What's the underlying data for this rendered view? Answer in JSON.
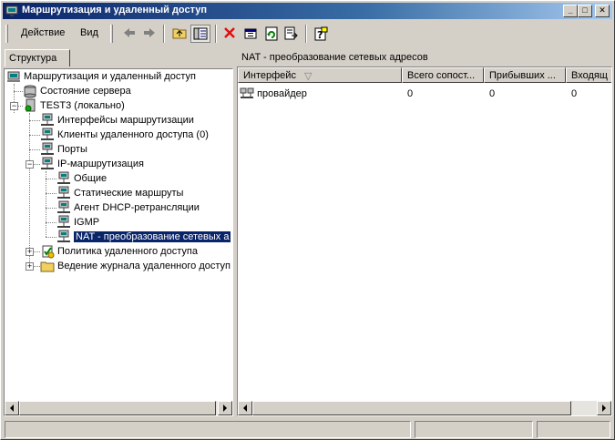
{
  "window": {
    "title": "Маршрутизация и удаленный доступ",
    "controls": {
      "minimize": "_",
      "maximize": "□",
      "close": "✕"
    }
  },
  "menu": {
    "action": "Действие",
    "view": "Вид"
  },
  "toolbar": {
    "icons": [
      "back-arrow-icon",
      "forward-arrow-icon",
      "up-folder-icon",
      "show-hide-tree-icon",
      "delete-icon",
      "properties-icon",
      "refresh-icon",
      "export-list-icon",
      "help-icon"
    ]
  },
  "left_panel": {
    "tab": "Структура",
    "tree": [
      {
        "label": "Маршрутизация и удаленный доступ",
        "icon": "routing-icon"
      },
      {
        "label": "Состояние сервера",
        "icon": "server-status-icon"
      },
      {
        "label": "TEST3 (локально)",
        "icon": "server-icon"
      },
      {
        "label": "Интерфейсы маршрутизации",
        "icon": "network-icon"
      },
      {
        "label": "Клиенты удаленного доступа (0)",
        "icon": "network-icon"
      },
      {
        "label": "Порты",
        "icon": "network-icon"
      },
      {
        "label": "IP-маршрутизация",
        "icon": "network-icon"
      },
      {
        "label": "Общие",
        "icon": "network-icon"
      },
      {
        "label": "Статические маршруты",
        "icon": "network-icon"
      },
      {
        "label": "Агент DHCP-ретрансляции",
        "icon": "network-icon"
      },
      {
        "label": "IGMP",
        "icon": "network-icon"
      },
      {
        "label": "NAT - преобразование сетевых а",
        "icon": "network-icon",
        "selected": true
      },
      {
        "label": "Политика удаленного доступа",
        "icon": "policy-icon"
      },
      {
        "label": "Ведение журнала удаленного доступ",
        "icon": "folder-icon"
      }
    ]
  },
  "right_panel": {
    "header": "NAT - преобразование сетевых адресов",
    "columns": [
      "Интерфейс",
      "Всего сопост...",
      "Прибывших ...",
      "Входящ"
    ],
    "sort_indicator": "▽",
    "rows": [
      {
        "interface": "провайдер",
        "total": "0",
        "inbound": "0",
        "incoming": "0"
      }
    ]
  },
  "colors": {
    "face": "#d4d0c8",
    "title_start": "#0a246a",
    "title_end": "#a6caf0",
    "selection": "#0a246a"
  }
}
